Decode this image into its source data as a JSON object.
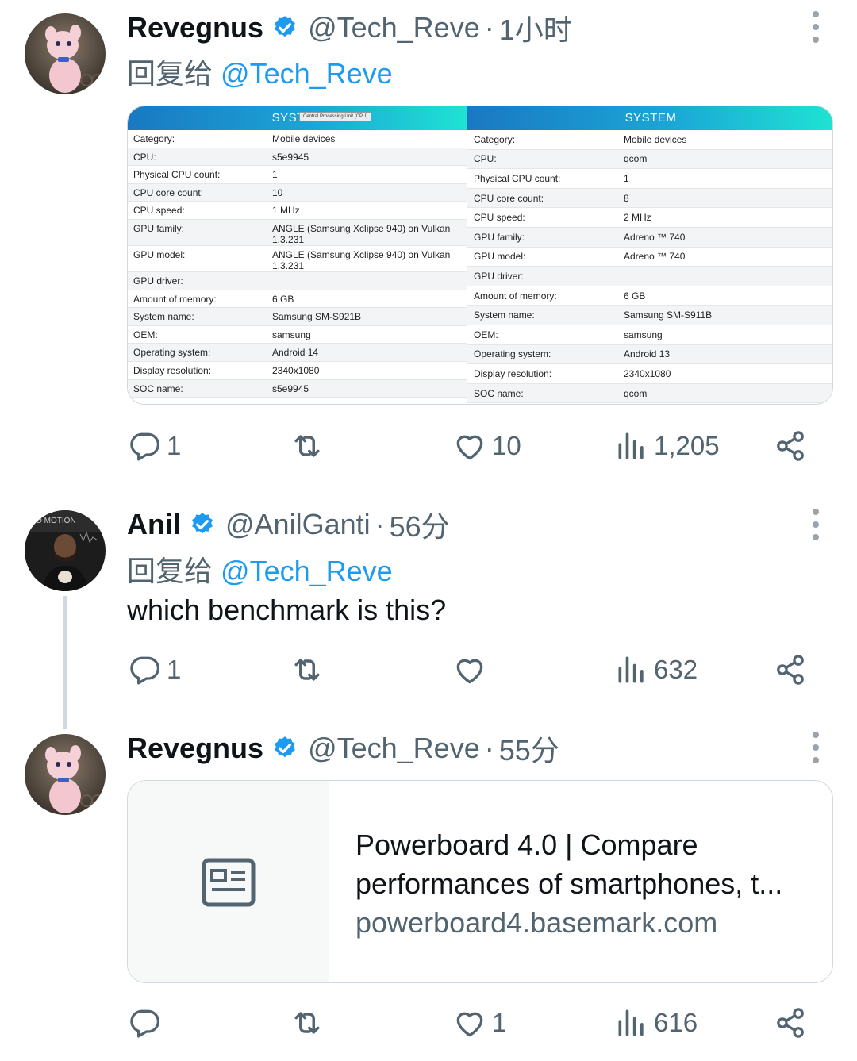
{
  "tweets": [
    {
      "name": "Revegnus",
      "handle": "@Tech_Reve",
      "time": "1小时",
      "reply_prefix": "回复给",
      "reply_to": "@Tech_Reve",
      "stats": {
        "replies": "1",
        "likes": "10",
        "views": "1,205"
      },
      "image": {
        "left": {
          "title": "SYSTEM",
          "tooltip": "Central Processing Unit (CPU)",
          "rows": [
            {
              "k": "Category:",
              "v": "Mobile devices"
            },
            {
              "k": "CPU:",
              "v": "s5e9945"
            },
            {
              "k": "Physical CPU count:",
              "v": "1"
            },
            {
              "k": "CPU core count:",
              "v": "10"
            },
            {
              "k": "CPU speed:",
              "v": "1 MHz"
            },
            {
              "k": "GPU family:",
              "v": "ANGLE (Samsung Xclipse 940) on Vulkan 1.3.231"
            },
            {
              "k": "GPU model:",
              "v": "ANGLE (Samsung Xclipse 940) on Vulkan 1.3.231"
            },
            {
              "k": "GPU driver:",
              "v": ""
            },
            {
              "k": "Amount of memory:",
              "v": "6 GB"
            },
            {
              "k": "System name:",
              "v": "Samsung SM-S921B"
            },
            {
              "k": "OEM:",
              "v": "samsung"
            },
            {
              "k": "Operating system:",
              "v": "Android 14"
            },
            {
              "k": "Display resolution:",
              "v": "2340x1080"
            },
            {
              "k": "SOC name:",
              "v": "s5e9945"
            }
          ]
        },
        "right": {
          "title": "SYSTEM",
          "rows": [
            {
              "k": "Category:",
              "v": "Mobile devices"
            },
            {
              "k": "CPU:",
              "v": "qcom"
            },
            {
              "k": "Physical CPU count:",
              "v": "1"
            },
            {
              "k": "CPU core count:",
              "v": "8"
            },
            {
              "k": "CPU speed:",
              "v": "2 MHz"
            },
            {
              "k": "GPU family:",
              "v": "Adreno ™ 740"
            },
            {
              "k": "GPU model:",
              "v": "Adreno ™ 740"
            },
            {
              "k": "GPU driver:",
              "v": ""
            },
            {
              "k": "Amount of memory:",
              "v": "6 GB"
            },
            {
              "k": "System name:",
              "v": "Samsung SM-S911B"
            },
            {
              "k": "OEM:",
              "v": "samsung"
            },
            {
              "k": "Operating system:",
              "v": "Android 13"
            },
            {
              "k": "Display resolution:",
              "v": "2340x1080"
            },
            {
              "k": "SOC name:",
              "v": "qcom"
            }
          ]
        }
      }
    },
    {
      "name": "Anil",
      "handle": "@AnilGanti",
      "time": "56分",
      "reply_prefix": "回复给",
      "reply_to": "@Tech_Reve",
      "text": "which benchmark is this?",
      "stats": {
        "replies": "1",
        "likes": "",
        "views": "632"
      }
    },
    {
      "name": "Revegnus",
      "handle": "@Tech_Reve",
      "time": "55分",
      "link_card": {
        "title": "Powerboard 4.0 | Compare performances of smartphones, t...",
        "domain": "powerboard4.basemark.com"
      },
      "stats": {
        "replies": "",
        "likes": "1",
        "views": "616"
      }
    }
  ],
  "colors": {
    "link": "#1d9bf0",
    "muted": "#536471",
    "verified": "#1d9bf0"
  },
  "avatar_icons": [
    "pink-creature-avatar",
    "man-portrait-avatar"
  ]
}
